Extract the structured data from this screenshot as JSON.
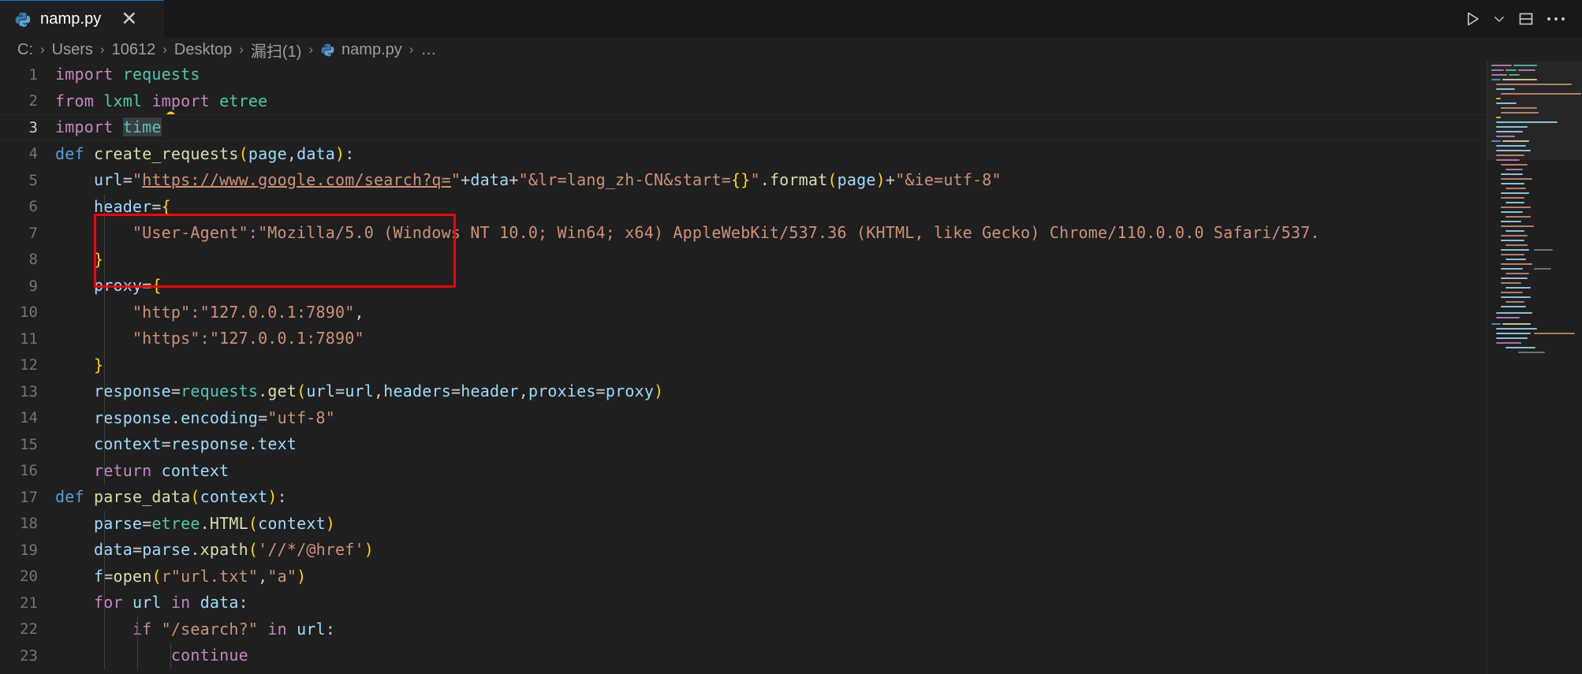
{
  "window": {
    "title": "namp.py",
    "background": "#1f1f1f",
    "tabbar_background": "#181818",
    "accent": "#0078d4"
  },
  "tab": {
    "label": "namp.py",
    "icon": "python-file-icon",
    "close_label": "✕",
    "active": true
  },
  "toolbar": {
    "run_label": "run-python-file",
    "run_dropdown_label": "run-options",
    "split_label": "split-editor-down",
    "more_label": "more-actions"
  },
  "breadcrumb": {
    "separator": "›",
    "items": [
      {
        "label": "C:",
        "icon": null
      },
      {
        "label": "Users",
        "icon": null
      },
      {
        "label": "10612",
        "icon": null
      },
      {
        "label": "Desktop",
        "icon": null
      },
      {
        "label": "漏扫(1)",
        "icon": null
      },
      {
        "label": "namp.py",
        "icon": "python-file-icon"
      },
      {
        "label": "…",
        "icon": null
      }
    ]
  },
  "annotation": {
    "type": "rectangle-highlight",
    "color": "#ff0000",
    "covers_lines": [
      9,
      10,
      11
    ]
  },
  "editor": {
    "language": "Python",
    "current_line": 3,
    "selection_text": "time",
    "lightbulb_line": 2,
    "first_line": 1,
    "last_visible_line": 23,
    "lines": [
      {
        "n": 1,
        "text": "import requests"
      },
      {
        "n": 2,
        "text": "from lxml import etree"
      },
      {
        "n": 3,
        "text": "import time"
      },
      {
        "n": 4,
        "text": "def create_requests(page,data):"
      },
      {
        "n": 5,
        "text": "    url=\"https://www.google.com/search?q=\"+data+\"&lr=lang_zh-CN&start={}\".format(page)+\"&ie=utf-8\""
      },
      {
        "n": 6,
        "text": "    header={"
      },
      {
        "n": 7,
        "text": "        \"User-Agent\":\"Mozilla/5.0 (Windows NT 10.0; Win64; x64) AppleWebKit/537.36 (KHTML, like Gecko) Chrome/110.0.0.0 Safari/537."
      },
      {
        "n": 8,
        "text": "    }"
      },
      {
        "n": 9,
        "text": "    proxy={"
      },
      {
        "n": 10,
        "text": "        \"http\":\"127.0.0.1:7890\","
      },
      {
        "n": 11,
        "text": "        \"https\":\"127.0.0.1:7890\""
      },
      {
        "n": 12,
        "text": "    }"
      },
      {
        "n": 13,
        "text": "    response=requests.get(url=url,headers=header,proxies=proxy)"
      },
      {
        "n": 14,
        "text": "    response.encoding=\"utf-8\""
      },
      {
        "n": 15,
        "text": "    context=response.text"
      },
      {
        "n": 16,
        "text": "    return context"
      },
      {
        "n": 17,
        "text": "def parse_data(context):"
      },
      {
        "n": 18,
        "text": "    parse=etree.HTML(context)"
      },
      {
        "n": 19,
        "text": "    data=parse.xpath('//*/@href')"
      },
      {
        "n": 20,
        "text": "    f=open(r\"url.txt\",\"a\")"
      },
      {
        "n": 21,
        "text": "    for url in data:"
      },
      {
        "n": 22,
        "text": "        if \"/search?\" in url:"
      },
      {
        "n": 23,
        "text": "            continue"
      }
    ]
  },
  "minimap": {
    "label": "minimap",
    "visible": true
  },
  "colors": {
    "keyword": "#c586c0",
    "declaration": "#569cd6",
    "function": "#dcdcaa",
    "variable": "#9cdcfe",
    "module": "#4ec9b0",
    "string": "#ce9178",
    "bracket_yellow": "#ffd700",
    "bracket_pink": "#da70d6",
    "line_number": "#6e7681",
    "foreground": "#cccccc"
  }
}
